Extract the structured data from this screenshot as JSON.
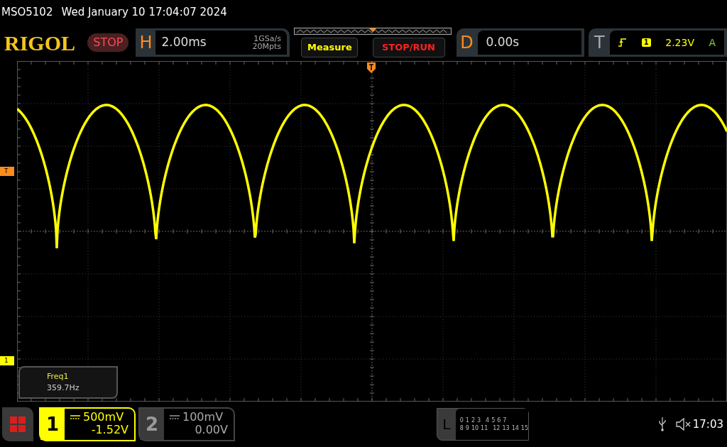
{
  "header": {
    "model": "MSO5102",
    "datetime": "Wed January 10 17:04:07 2024"
  },
  "logo": "RIGOL",
  "run_status": "STOP",
  "horizontal": {
    "label": "H",
    "timebase": "2.00ms",
    "sample_rate": "1GSa/s",
    "memory_depth": "20Mpts"
  },
  "buttons": [
    "Measure",
    "STOP/RUN"
  ],
  "delay": {
    "label": "D",
    "value": "0.00s"
  },
  "trigger": {
    "label": "T",
    "source": "1",
    "level": "2.23V",
    "mode": "A"
  },
  "markers": {
    "trigger_level": "T",
    "channel_1": "1"
  },
  "measurement": {
    "name": "Freq1",
    "value": "359.7Hz"
  },
  "channels": [
    {
      "number": "1",
      "scale": "500mV",
      "offset": "-1.52V",
      "selected": true
    },
    {
      "number": "2",
      "scale": "100mV",
      "offset": "0.00V",
      "selected": false
    }
  ],
  "logic": {
    "label": "L",
    "row_1": [
      "0",
      "1",
      "2",
      "3",
      "4",
      "5",
      "6",
      "7"
    ],
    "row_2": [
      "8",
      "9",
      "10",
      "11",
      "12",
      "13",
      "14",
      "15"
    ]
  },
  "status": {
    "time": "17:03"
  }
}
